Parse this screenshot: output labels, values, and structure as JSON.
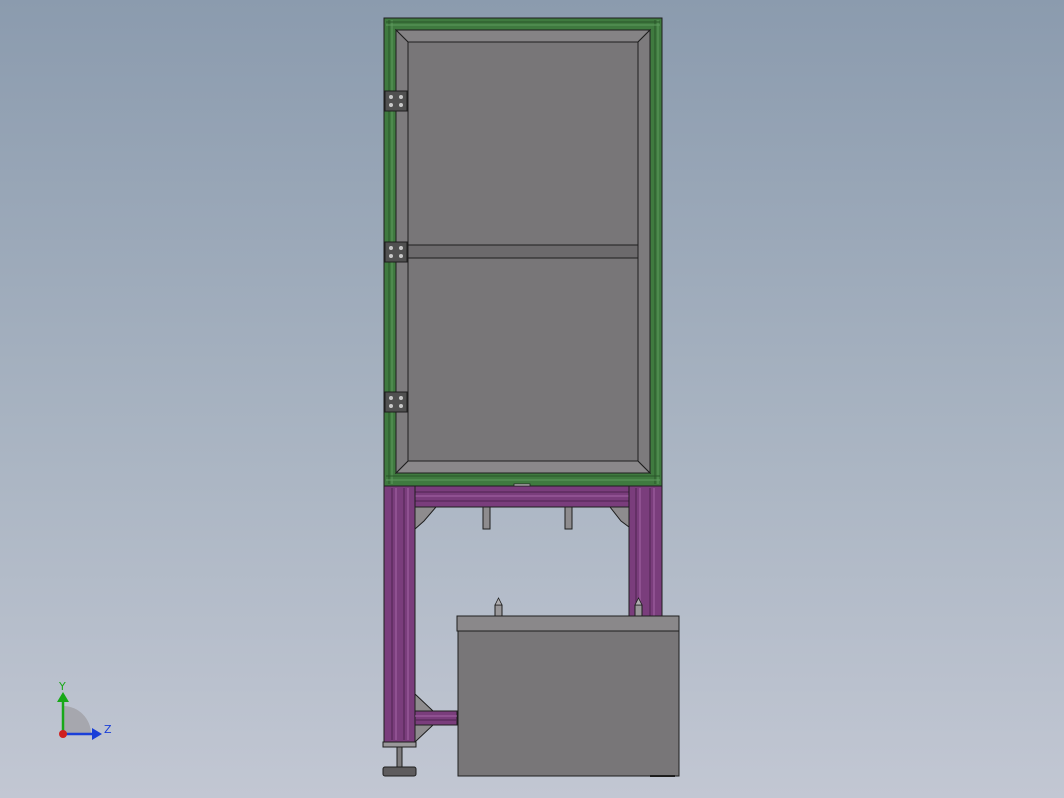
{
  "triad": {
    "y_label": "Y",
    "z_label": "Z",
    "colors": {
      "y": "#18a818",
      "z": "#1a3fd8",
      "x": "#d02020"
    }
  },
  "colors": {
    "background_top": "#8b9bae",
    "background_bottom": "#c2c7d3",
    "cabinet_frame": "#3f7a3f",
    "stand_frame": "#7a3d7c",
    "panel_fill": "#787678",
    "edge": "#1e1e1e",
    "metal": "#8e8c8e"
  }
}
